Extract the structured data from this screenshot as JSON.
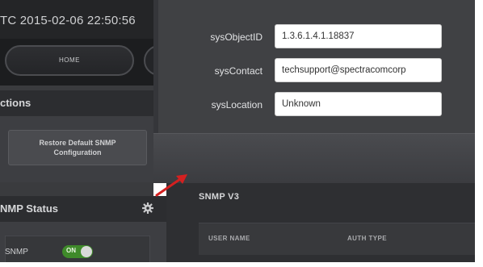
{
  "header": {
    "utc_text": "TC  2015-02-06 22:50:56"
  },
  "nav": {
    "home_label": "HOME"
  },
  "actions": {
    "title": "ctions",
    "restore_line1": "Restore Default SNMP",
    "restore_line2": "Configuration"
  },
  "status": {
    "title": "NMP Status",
    "snmp_label": "SNMP",
    "toggle_label": "ON",
    "toggle_state": "on"
  },
  "form": {
    "fields": [
      {
        "label": "sysObjectID",
        "value": "1.3.6.1.4.1.18837"
      },
      {
        "label": "sysContact",
        "value": "techsupport@spectracomcorp"
      },
      {
        "label": "sysLocation",
        "value": "Unknown"
      }
    ]
  },
  "snmpv3": {
    "title": "SNMP V3",
    "columns": [
      "USER NAME",
      "AUTH TYPE"
    ]
  },
  "colors": {
    "panel_dark": "#2c2d30",
    "panel_mid": "#404144",
    "toggle_on": "#3f8a2a",
    "arrow": "#d42020"
  },
  "icons": [
    "gear-icon",
    "annotation-arrow-icon"
  ]
}
